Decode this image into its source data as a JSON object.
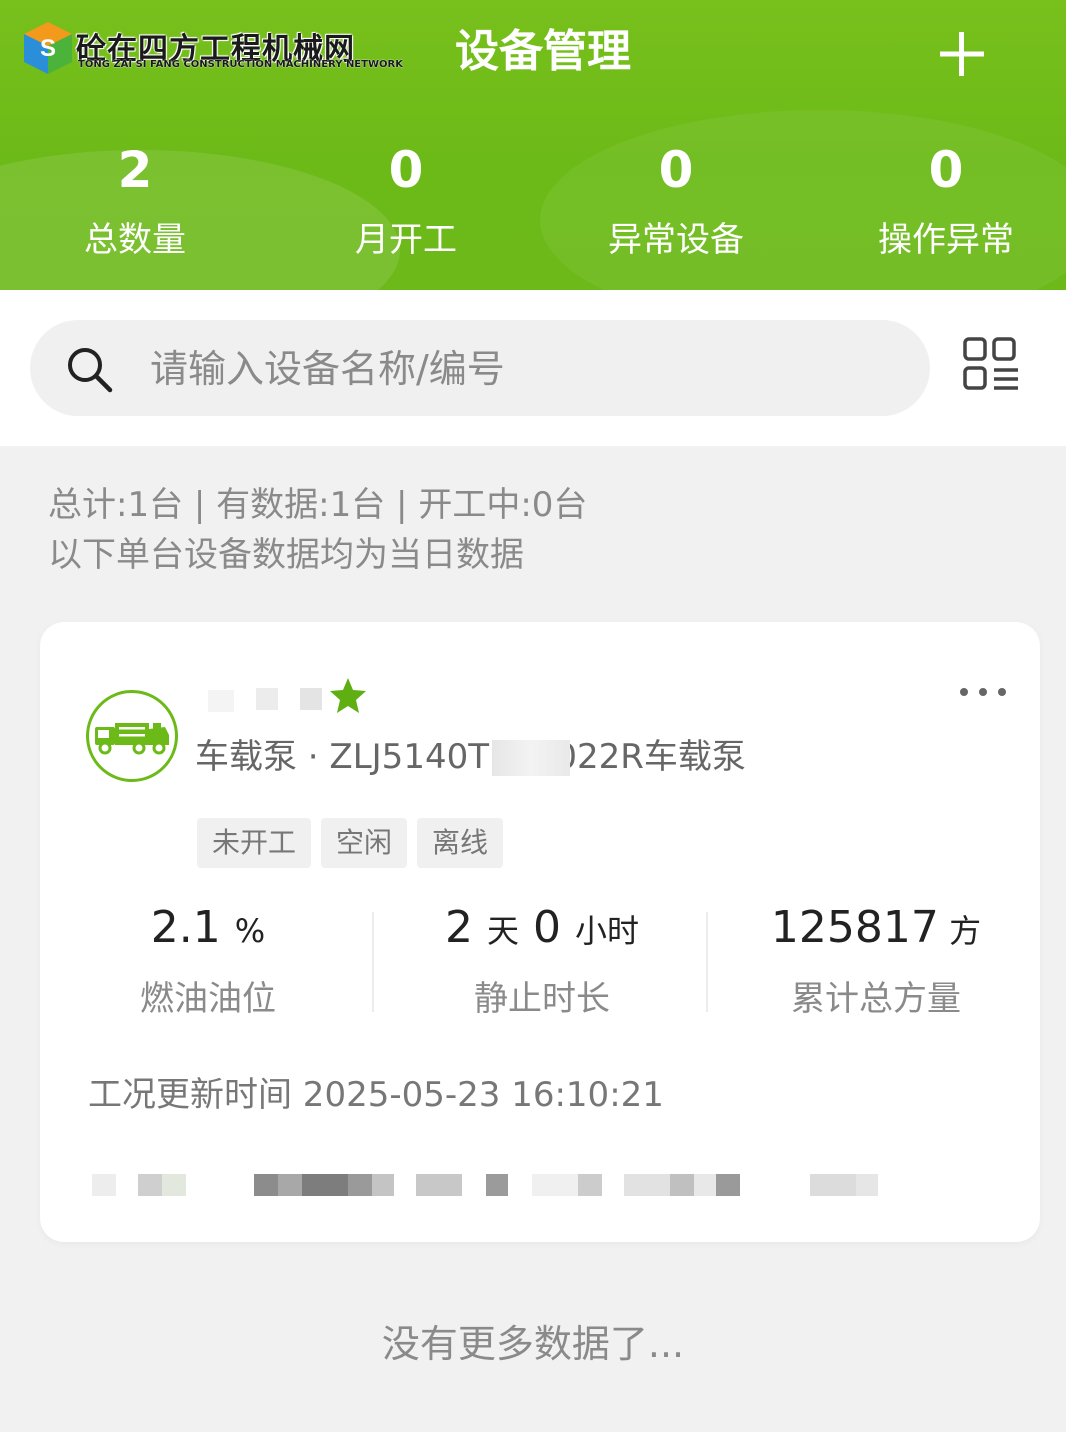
{
  "watermark": {
    "name_cn": "砼在四方工程机械网",
    "name_en": "TONG ZAI SI FANG CONSTRUCTION MACHINERY NETWORK"
  },
  "header": {
    "title": "设备管理",
    "add_icon": "plus-icon",
    "stats": [
      {
        "value": "2",
        "label": "总数量"
      },
      {
        "value": "0",
        "label": "月开工"
      },
      {
        "value": "0",
        "label": "异常设备"
      },
      {
        "value": "0",
        "label": "操作异常"
      }
    ]
  },
  "search": {
    "placeholder": "请输入设备名称/编号",
    "icon": "search-icon",
    "view_toggle_icon": "grid-list-icon"
  },
  "summary": {
    "line1": "总计:1台 | 有数据:1台 | 开工中:0台",
    "line2": "以下单台设备数据均为当日数据"
  },
  "device_card": {
    "avatar_icon": "pump-truck-icon",
    "favorite_icon": "star-icon",
    "more_icon": "more-dots-icon",
    "type_model": "车载泵 · ZLJ5140T        -10022R车载泵",
    "tags": [
      "未开工",
      "空闲",
      "离线"
    ],
    "metrics": [
      {
        "value": "2.1",
        "unit": "%",
        "label": "燃油油位"
      },
      {
        "value": "2 ",
        "unit": "天",
        "value2": " 0 ",
        "unit2": "小时",
        "label": "静止时长"
      },
      {
        "value": "125817",
        "unit": " 方",
        "label": "累计总方量"
      }
    ],
    "update_time": "工况更新时间 2025-05-23 16:10:21"
  },
  "footer": {
    "no_more": "没有更多数据了..."
  },
  "colors": {
    "brand_green": "#6cba18",
    "text_gray": "#8a8a8a",
    "background": "#f1f1f1"
  }
}
